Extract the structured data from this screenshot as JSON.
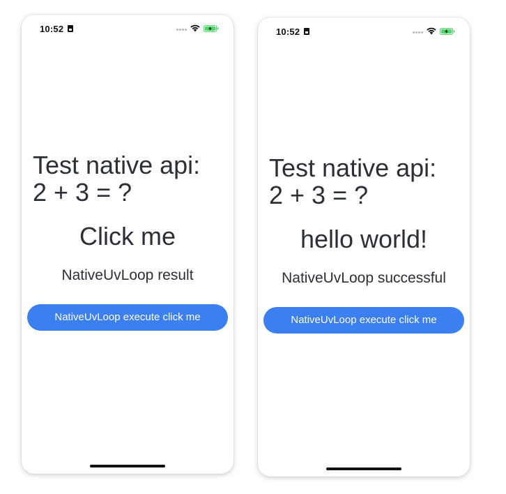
{
  "screens": [
    {
      "status_bar": {
        "time": "10:52",
        "icons": [
          "sim-card-icon",
          "cellular-signal-icon",
          "wifi-icon",
          "battery-charging-icon"
        ]
      },
      "title": "Test native api:\n2 + 3 = ?",
      "result": "Click me",
      "status": "NativeUvLoop result",
      "button_label": "NativeUvLoop execute click me"
    },
    {
      "status_bar": {
        "time": "10:52",
        "icons": [
          "sim-card-icon",
          "cellular-signal-icon",
          "wifi-icon",
          "battery-charging-icon"
        ]
      },
      "title": "Test native api:\n2 + 3 = ?",
      "result": "hello world!",
      "status": "NativeUvLoop successful",
      "button_label": "NativeUvLoop execute click me"
    }
  ],
  "colors": {
    "text": "#2b2f36",
    "button": "#3b7ff1",
    "button_text": "#ffffff",
    "battery": "#4cd964"
  }
}
